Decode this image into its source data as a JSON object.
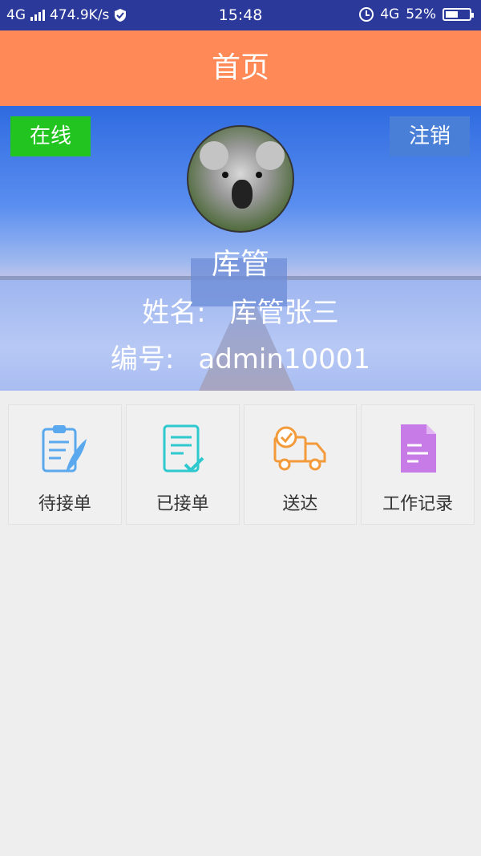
{
  "status_bar": {
    "network": "4G",
    "speed": "474.9K/s",
    "time": "15:48",
    "network_right": "4G",
    "battery": "52%",
    "battery_level": 0.52
  },
  "header": {
    "title": "首页"
  },
  "profile": {
    "status_button": "在线",
    "logout_button": "注销",
    "role": "库管",
    "name_label": "姓名:",
    "name_value": "库管张三",
    "id_label": "编号:",
    "id_value": "admin10001"
  },
  "menu": {
    "items": [
      {
        "label": "待接单",
        "icon": "clipboard-feather-icon",
        "color": "#5aa8ee"
      },
      {
        "label": "已接单",
        "icon": "document-check-icon",
        "color": "#2ec9cf"
      },
      {
        "label": "送达",
        "icon": "delivery-truck-icon",
        "color": "#f39a3b"
      },
      {
        "label": "工作记录",
        "icon": "work-log-document-icon",
        "color": "#c77be6"
      }
    ]
  },
  "colors": {
    "status_bar": "#2b3a9a",
    "header": "#ff8a57",
    "online": "#22c41f",
    "logout": "#4a7fd8"
  }
}
